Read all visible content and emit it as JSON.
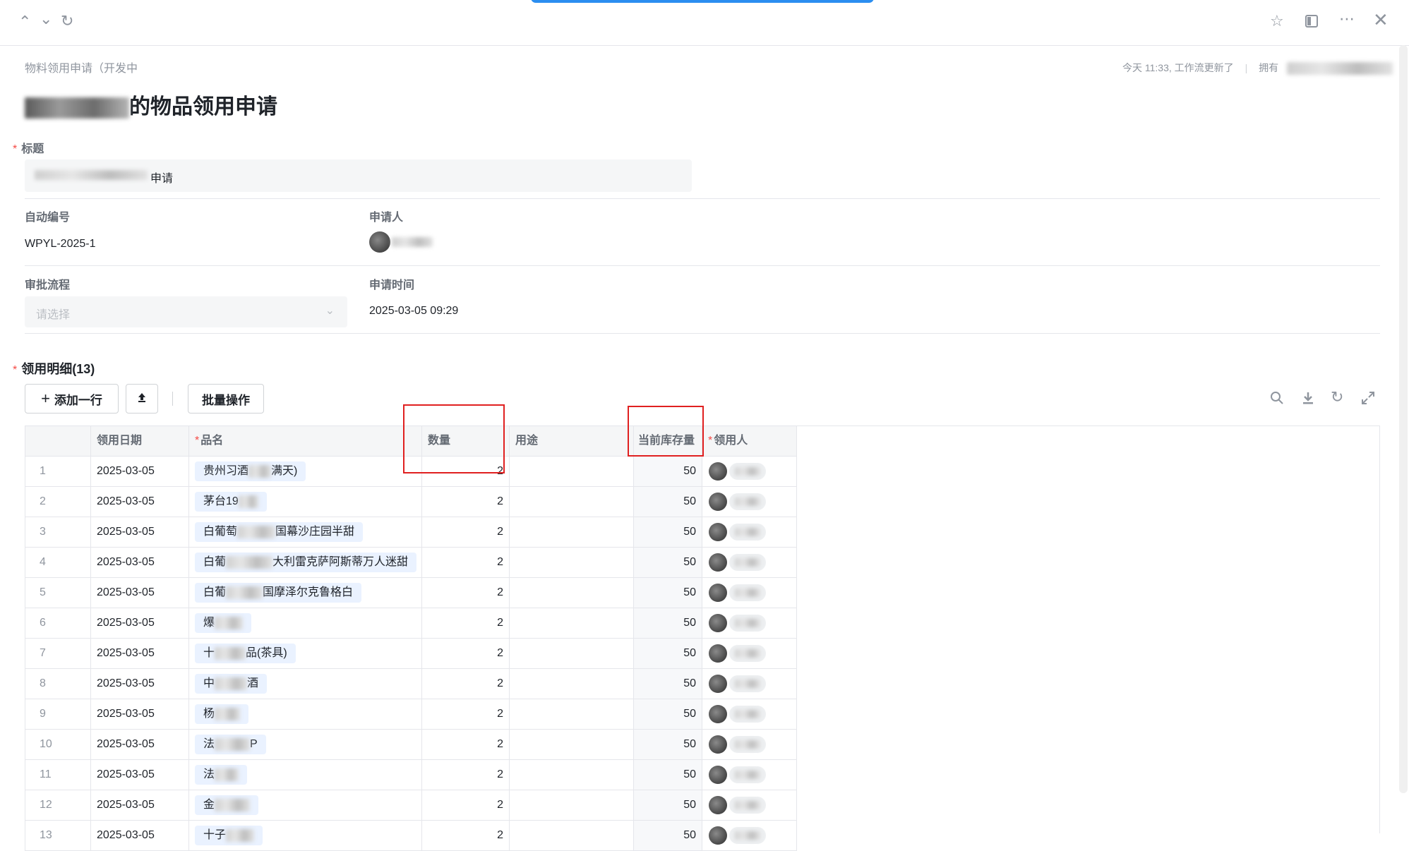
{
  "window": {
    "icons": [
      "chevron-up-icon",
      "chevron-down-icon",
      "refresh-icon",
      "star-icon",
      "sidebar-toggle-icon",
      "more-icon",
      "close-icon"
    ]
  },
  "page": {
    "breadcrumb": "物料领用申请（开发中",
    "meta": "今天 11:33, 工作流更新了",
    "owner_label": "拥有",
    "title_suffix": "的物品领用申请"
  },
  "form": {
    "title_label": "标题",
    "title_value_suffix": "申请",
    "auto_no_label": "自动编号",
    "auto_no_value": "WPYL-2025-1",
    "applicant_label": "申请人",
    "flow_label": "审批流程",
    "flow_placeholder": "请选择",
    "time_label": "申请时间",
    "time_value": "2025-03-05 09:29"
  },
  "detail": {
    "section_label": "领用明细(13)",
    "add_row_label": "添加一行",
    "batch_label": "批量操作",
    "toolbar_icons": [
      "search-icon",
      "download-icon",
      "refresh-icon",
      "fullscreen-icon"
    ],
    "columns": [
      "",
      "领用日期",
      "品名",
      "数量",
      "用途",
      "当前库存量",
      "领用人"
    ],
    "rows": [
      {
        "no": "1",
        "date": "2025-03-05",
        "name": "贵州习酒",
        "name_tail": "满天)",
        "qty": "2",
        "use": "",
        "stock": "50"
      },
      {
        "no": "2",
        "date": "2025-03-05",
        "name": "茅台19",
        "name_tail": "",
        "qty": "2",
        "use": "",
        "stock": "50"
      },
      {
        "no": "3",
        "date": "2025-03-05",
        "name": "白葡萄",
        "name_tail": "国幕沙庄园半甜",
        "qty": "2",
        "use": "",
        "stock": "50"
      },
      {
        "no": "4",
        "date": "2025-03-05",
        "name": "白葡",
        "name_tail": "大利雷克萨阿斯蒂万人迷甜",
        "qty": "2",
        "use": "",
        "stock": "50"
      },
      {
        "no": "5",
        "date": "2025-03-05",
        "name": "白葡",
        "name_tail": "国摩泽尔克鲁格白",
        "qty": "2",
        "use": "",
        "stock": "50"
      },
      {
        "no": "6",
        "date": "2025-03-05",
        "name": "爆",
        "name_tail": "",
        "qty": "2",
        "use": "",
        "stock": "50"
      },
      {
        "no": "7",
        "date": "2025-03-05",
        "name": "十",
        "name_tail": "品(茶具)",
        "qty": "2",
        "use": "",
        "stock": "50"
      },
      {
        "no": "8",
        "date": "2025-03-05",
        "name": "中",
        "name_tail": "酒",
        "qty": "2",
        "use": "",
        "stock": "50"
      },
      {
        "no": "9",
        "date": "2025-03-05",
        "name": "杨",
        "name_tail": "",
        "qty": "2",
        "use": "",
        "stock": "50"
      },
      {
        "no": "10",
        "date": "2025-03-05",
        "name": "法",
        "name_tail": "P",
        "qty": "2",
        "use": "",
        "stock": "50"
      },
      {
        "no": "11",
        "date": "2025-03-05",
        "name": "法",
        "name_tail": "",
        "qty": "2",
        "use": "",
        "stock": "50"
      },
      {
        "no": "12",
        "date": "2025-03-05",
        "name": "金",
        "name_tail": "",
        "qty": "2",
        "use": "",
        "stock": "50"
      },
      {
        "no": "13",
        "date": "2025-03-05",
        "name": "十子",
        "name_tail": "",
        "qty": "2",
        "use": "",
        "stock": "50"
      }
    ]
  },
  "colors": {
    "accent": "#2b8ef0",
    "required": "#f54a45",
    "highlight_box": "#e02020",
    "tag_bg": "#eaf2ff"
  }
}
